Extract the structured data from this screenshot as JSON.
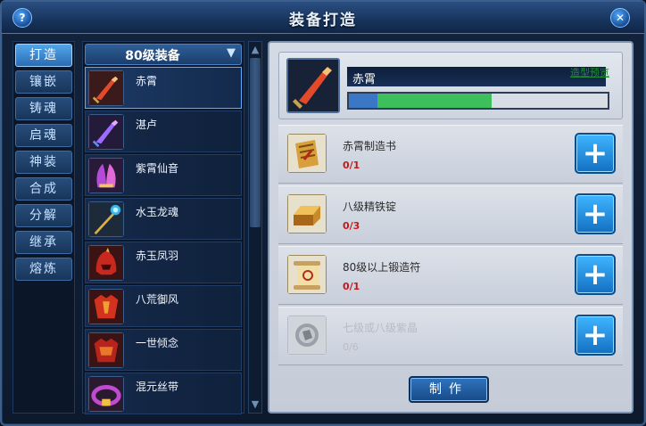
{
  "window": {
    "title": "装备打造",
    "help_glyph": "?",
    "close_glyph": "✕"
  },
  "tabs": [
    {
      "label": "打造",
      "active": true
    },
    {
      "label": "镶嵌"
    },
    {
      "label": "铸魂"
    },
    {
      "label": "启魂"
    },
    {
      "label": "神装"
    },
    {
      "label": "合成"
    },
    {
      "label": "分解"
    },
    {
      "label": "继承"
    },
    {
      "label": "熔炼"
    }
  ],
  "list": {
    "header": "80级装备",
    "items": [
      {
        "name": "赤霄",
        "icon": "sword-icon",
        "selected": true
      },
      {
        "name": "湛卢",
        "icon": "sword-icon"
      },
      {
        "name": "紫霄仙音",
        "icon": "lyre-icon"
      },
      {
        "name": "水玉龙魂",
        "icon": "staff-icon"
      },
      {
        "name": "赤玉凤羽",
        "icon": "helmet-icon"
      },
      {
        "name": "八荒御风",
        "icon": "armor-icon"
      },
      {
        "name": "一世倾念",
        "icon": "armor-icon"
      },
      {
        "name": "混元丝带",
        "icon": "belt-icon"
      }
    ]
  },
  "target": {
    "name": "赤霄",
    "preview_label": "造型预览",
    "progress": 0.55
  },
  "materials": [
    {
      "name": "赤霄制造书",
      "count": "0/1",
      "icon": "book-icon",
      "available": true
    },
    {
      "name": "八级精铁锭",
      "count": "0/3",
      "icon": "ingot-icon",
      "available": true
    },
    {
      "name": "80级以上锻造符",
      "count": "0/1",
      "icon": "scroll-icon",
      "available": true
    },
    {
      "name": "七级或八级紫晶",
      "count": "0/6",
      "icon": "crystal-icon",
      "available": false
    }
  ],
  "actions": {
    "make_label": "制作",
    "plus_glyph": "+"
  },
  "colors": {
    "accent": "#2a6cb4",
    "shortage": "#c21a1a",
    "preview_link": "#1e8f2e"
  }
}
